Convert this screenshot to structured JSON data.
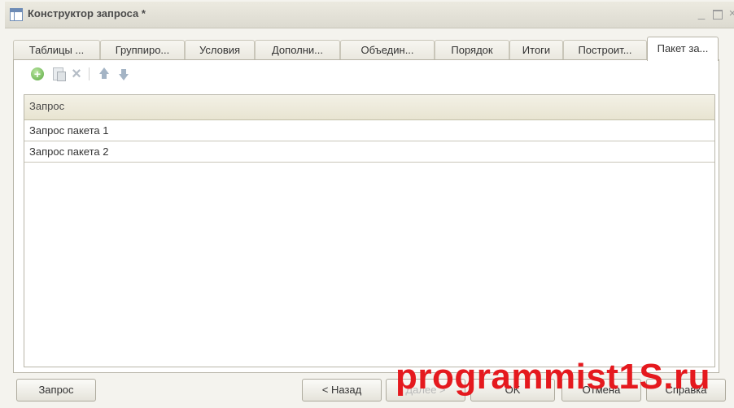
{
  "window": {
    "title": "Конструктор запроса *",
    "minimize_glyph": "_",
    "close_glyph": "×"
  },
  "tabs": [
    {
      "label": "Таблицы ..."
    },
    {
      "label": "Группиро..."
    },
    {
      "label": "Условия"
    },
    {
      "label": "Дополни..."
    },
    {
      "label": "Объедин..."
    },
    {
      "label": "Порядок"
    },
    {
      "label": "Итоги"
    },
    {
      "label": "Построит..."
    },
    {
      "label": "Пакет за..."
    }
  ],
  "active_tab": "Пакет за...",
  "toolbar": {
    "icons": [
      "add-icon",
      "copy-icon",
      "delete-icon",
      "move-up-icon",
      "move-down-icon"
    ]
  },
  "grid": {
    "column_header": "Запрос",
    "rows": [
      "Запрос пакета 1",
      "Запрос пакета 2"
    ]
  },
  "buttons": {
    "query": "Запрос",
    "back": "< Назад",
    "next": "Далее >",
    "ok": "OK",
    "cancel": "Отмена",
    "help": "Справка"
  },
  "watermark": "programmist1S.ru",
  "colors": {
    "accent_watermark": "#e5191e",
    "window_bg": "#f4f3ee",
    "header_bg": "#e8e4d1"
  }
}
